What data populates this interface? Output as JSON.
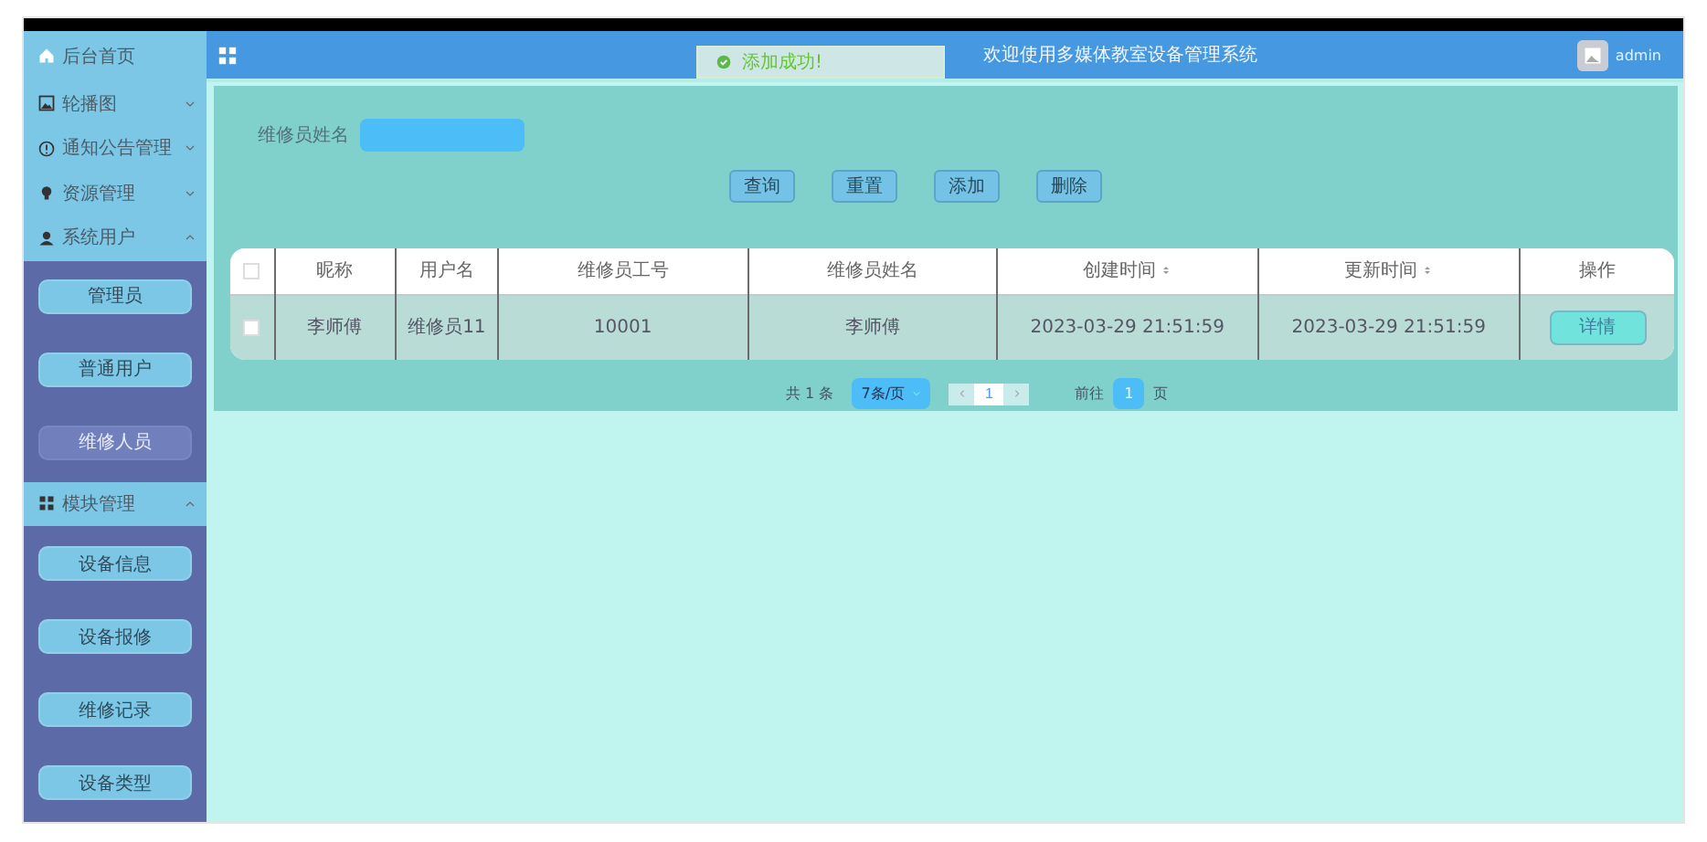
{
  "sidebar": {
    "items": [
      {
        "label": "后台首页",
        "expanded": false
      },
      {
        "label": "轮播图",
        "expanded": false
      },
      {
        "label": "通知公告管理",
        "expanded": false
      },
      {
        "label": "资源管理",
        "expanded": false
      },
      {
        "label": "系统用户",
        "expanded": true,
        "children": [
          {
            "label": "管理员",
            "selected": false
          },
          {
            "label": "普通用户",
            "selected": false
          },
          {
            "label": "维修人员",
            "selected": true
          }
        ]
      },
      {
        "label": "模块管理",
        "expanded": true,
        "children": [
          {
            "label": "设备信息",
            "selected": false
          },
          {
            "label": "设备报修",
            "selected": false
          },
          {
            "label": "维修记录",
            "selected": false
          },
          {
            "label": "设备类型",
            "selected": false
          }
        ]
      }
    ]
  },
  "header": {
    "title": "欢迎使用多媒体教室设备管理系统",
    "user": "admin"
  },
  "toast": {
    "message": "添加成功!"
  },
  "search": {
    "label": "维修员姓名"
  },
  "buttons": [
    "查询",
    "重置",
    "添加",
    "删除"
  ],
  "table": {
    "all_checked": false,
    "columns": [
      {
        "label": "昵称",
        "sortable": false
      },
      {
        "label": "用户名",
        "sortable": false
      },
      {
        "label": "维修员工号",
        "sortable": false
      },
      {
        "label": "维修员姓名",
        "sortable": false
      },
      {
        "label": "创建时间",
        "sortable": true
      },
      {
        "label": "更新时间",
        "sortable": true
      },
      {
        "label": "操作",
        "sortable": false
      }
    ],
    "rows": [
      {
        "checked": false,
        "cells": [
          "李师傅",
          "维修员11",
          "10001",
          "李师傅",
          "2023-03-29 21:51:59",
          "2023-03-29 21:51:59"
        ],
        "action": "详情"
      }
    ]
  },
  "pagination": {
    "total": "共 1 条",
    "page_size": "7条/页",
    "current": "1",
    "goto_label": "前往",
    "goto_value": "1",
    "goto_suffix": "页"
  }
}
